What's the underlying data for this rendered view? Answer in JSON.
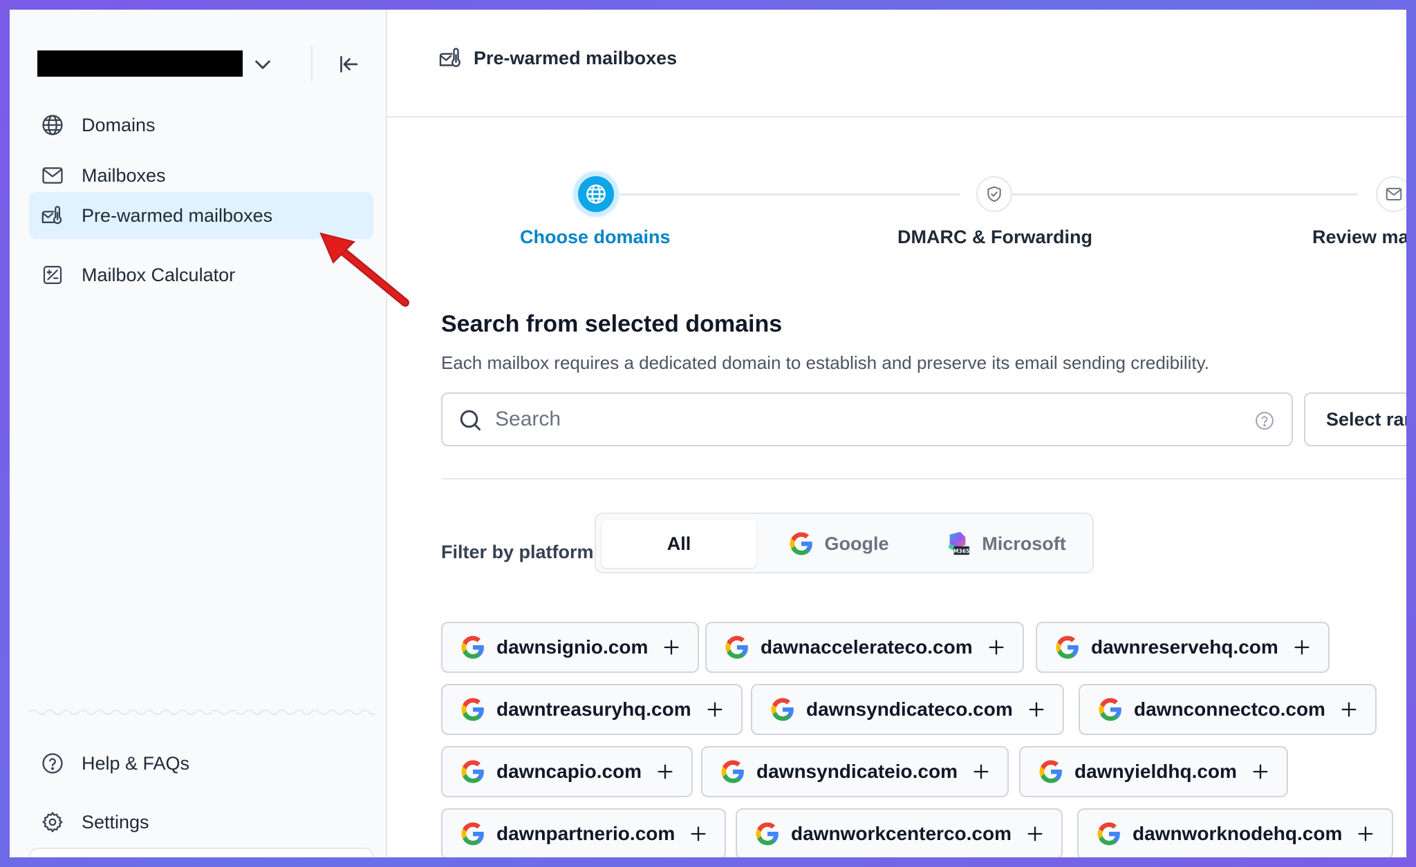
{
  "sidebar": {
    "nav": [
      {
        "label": "Domains",
        "icon": "globe-icon"
      },
      {
        "label": "Mailboxes",
        "icon": "mail-icon"
      },
      {
        "label": "Pre-warmed mailboxes",
        "icon": "warm-mailbox-icon",
        "active": true
      },
      {
        "label": "Mailbox Calculator",
        "icon": "calculator-icon"
      }
    ],
    "bottom": [
      {
        "label": "Help & FAQs",
        "icon": "help-circle-icon"
      },
      {
        "label": "Settings",
        "icon": "gear-icon"
      }
    ]
  },
  "header": {
    "title": "Pre-warmed mailboxes"
  },
  "stepper": {
    "steps": [
      {
        "label": "Choose domains",
        "active": true
      },
      {
        "label": "DMARC & Forwarding"
      },
      {
        "label": "Review mai"
      }
    ]
  },
  "section": {
    "title": "Search from selected domains",
    "subtitle": "Each mailbox requires a dedicated domain to establish and preserve its email sending credibility."
  },
  "search": {
    "placeholder": "Search",
    "value": ""
  },
  "select_random_label": "Select ran",
  "filter": {
    "label": "Filter by platform",
    "options": [
      "All",
      "Google",
      "Microsoft"
    ],
    "selected": "All"
  },
  "domains": [
    "dawnsignio.com",
    "dawnaccelerateco.com",
    "dawnreservehq.com",
    "dawntreasuryhq.com",
    "dawnsyndicateco.com",
    "dawnconnectco.com",
    "dawncapio.com",
    "dawnsyndicateio.com",
    "dawnyieldhq.com",
    "dawnpartnerio.com",
    "dawnworkcenterco.com",
    "dawnworknodehq.com"
  ],
  "colors": {
    "accent": "#0ea5e9",
    "accent_text": "#0284c7",
    "active_nav_bg": "#e0f2fe",
    "annotation_arrow": "#e11d1d"
  }
}
